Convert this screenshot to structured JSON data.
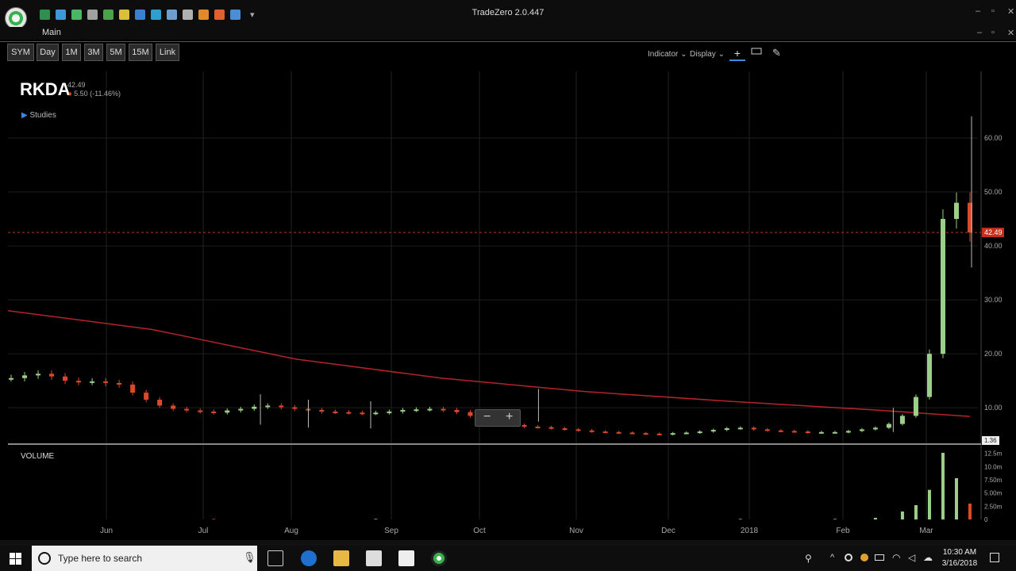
{
  "window": {
    "title": "TradeZero 2.0.447"
  },
  "menu": {
    "main": "Main"
  },
  "toolbar": {
    "timeframes": [
      "SYM",
      "Day",
      "1M",
      "3M",
      "5M",
      "15M",
      "Link"
    ],
    "indicator_label": "Indicator",
    "display_label": "Display"
  },
  "quote": {
    "symbol": "RKDA",
    "last": "42.49",
    "change": "5.50 (-11.46%)"
  },
  "studies_label": "Studies",
  "volume_label": "VOLUME",
  "chart_data": {
    "type": "candlestick",
    "symbol": "RKDA",
    "x_labels": [
      "Jun",
      "Jul",
      "Aug",
      "Sep",
      "Oct",
      "Nov",
      "Dec",
      "2018",
      "Feb",
      "Mar"
    ],
    "price_ticks": [
      "60.00",
      "50.00",
      "40.00",
      "30.00",
      "20.00",
      "10.00"
    ],
    "price_range": [
      4,
      65
    ],
    "last_price_marker": "42.49",
    "volume_ticks": [
      "12.5m",
      "10.0m",
      "7.50m",
      "5.00m",
      "2.50m",
      "0"
    ],
    "volume_marker": "1.36",
    "moving_average": [
      [
        0,
        28
      ],
      [
        0.15,
        24.5
      ],
      [
        0.3,
        19
      ],
      [
        0.45,
        15.5
      ],
      [
        0.6,
        13
      ],
      [
        0.75,
        11.2
      ],
      [
        0.9,
        9.6
      ],
      [
        1.0,
        8.4
      ]
    ],
    "close_series": [
      15.5,
      16,
      16.3,
      15.8,
      15,
      14.8,
      14.9,
      14.6,
      14.3,
      12.8,
      11.5,
      10.4,
      9.8,
      9.5,
      9.3,
      9.1,
      9.5,
      9.8,
      10.2,
      10.4,
      10.1,
      9.8,
      9.6,
      9.3,
      9.2,
      9.1,
      9,
      9.1,
      9.3,
      9.6,
      9.7,
      9.8,
      9.6,
      9.2,
      8.5,
      7.8,
      7.2,
      6.8,
      6.5,
      6.4,
      6.2,
      6,
      5.8,
      5.6,
      5.5,
      5.4,
      5.3,
      5.2,
      5.1,
      5.3,
      5.4,
      5.6,
      5.9,
      6.2,
      6.3,
      6.0,
      5.8,
      5.7,
      5.6,
      5.4,
      5.5,
      5.5,
      5.7,
      6.0,
      6.3,
      7.0,
      8.5,
      12,
      20,
      45,
      48,
      42.49
    ],
    "spikes": [
      [
        0.26,
        12.5
      ],
      [
        0.31,
        11.5
      ],
      [
        0.375,
        11.2
      ],
      [
        0.55,
        13.5
      ],
      [
        0.92,
        10
      ]
    ],
    "volume_series": [
      0,
      0,
      0,
      0,
      0,
      0,
      0,
      0,
      0,
      0,
      0,
      0,
      0,
      0,
      0,
      0.1,
      0,
      0,
      0,
      0,
      0,
      0,
      0,
      0,
      0,
      0,
      0,
      0.1,
      0,
      0,
      0,
      0,
      0,
      0,
      0,
      0,
      0,
      0,
      0,
      0,
      0,
      0,
      0,
      0,
      0,
      0,
      0,
      0,
      0,
      0,
      0,
      0,
      0,
      0,
      0.1,
      0,
      0,
      0,
      0,
      0,
      0,
      0.1,
      0,
      0,
      0.3,
      0,
      1.5,
      2.7,
      5.6,
      12.6,
      7.8,
      3.0
    ]
  },
  "taskbar": {
    "search_placeholder": "Type here to search",
    "time": "10:30 AM",
    "date": "3/16/2018"
  }
}
